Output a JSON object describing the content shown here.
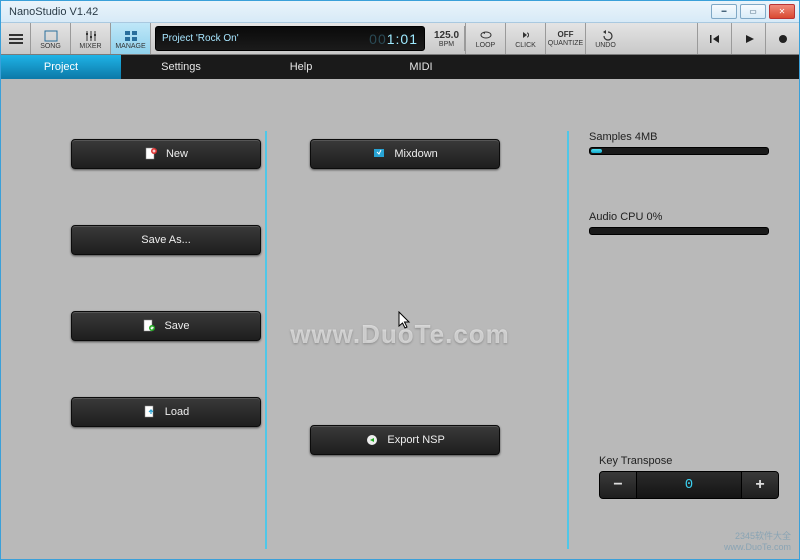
{
  "window": {
    "title": "NanoStudio V1.42"
  },
  "toolbar": {
    "song": "SONG",
    "mixer": "MIXER",
    "manage": "MANAGE",
    "project_name": "Project 'Rock On'",
    "time_lead": "00",
    "time_rest": "1:01",
    "bpm_value": "125.0",
    "bpm_label": "BPM",
    "loop": "LOOP",
    "click": "CLICK",
    "quantize_state": "OFF",
    "quantize": "QUANTIZE",
    "undo": "UNDO"
  },
  "tabs": {
    "project": "Project",
    "settings": "Settings",
    "help": "Help",
    "midi": "MIDI"
  },
  "buttons": {
    "new": "New",
    "save_as": "Save As...",
    "save": "Save",
    "load": "Load",
    "mixdown": "Mixdown",
    "export_nsp": "Export NSP"
  },
  "meters": {
    "samples_label": "Samples 4MB",
    "samples_pct": 6,
    "audio_cpu_label": "Audio CPU 0%",
    "audio_cpu_pct": 0
  },
  "key_transpose": {
    "label": "Key Transpose",
    "value": "0",
    "minus": "−",
    "plus": "+"
  },
  "watermark": "www.DuoTe.com",
  "corner": {
    "line1": "2345软件大全",
    "line2": "www.DuoTe.com"
  }
}
